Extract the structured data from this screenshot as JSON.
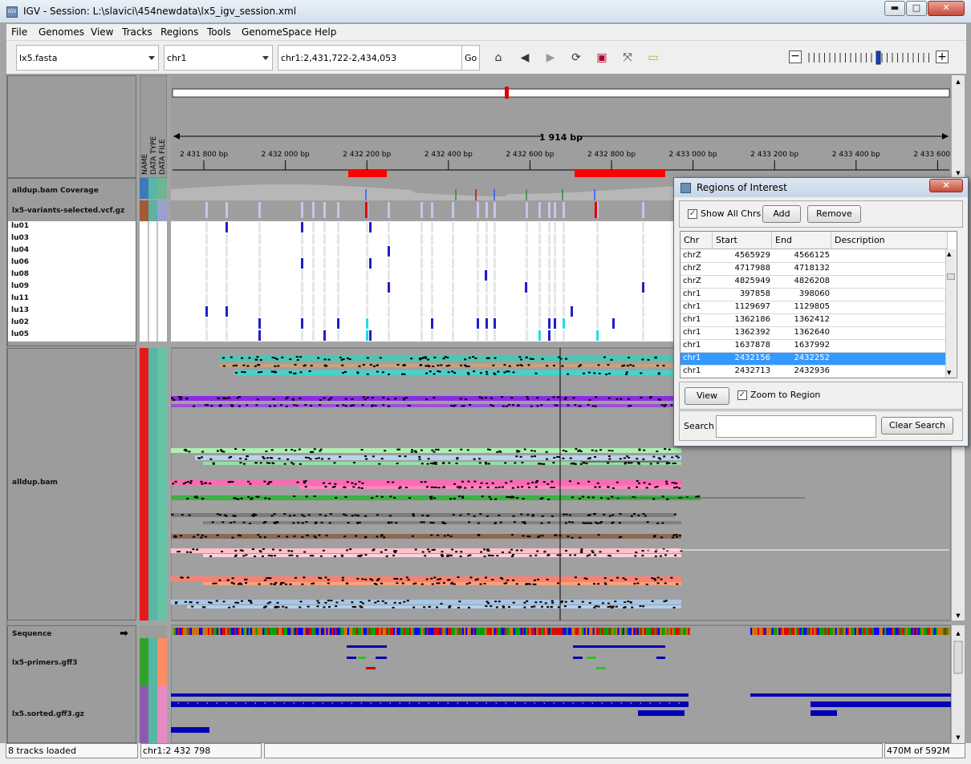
{
  "window": {
    "title": "IGV - Session: L:\\slavici\\454newdata\\lx5_igv_session.xml",
    "minimize": "▬",
    "maximize": "□",
    "close": "✕"
  },
  "menu": [
    "File",
    "Genomes",
    "View",
    "Tracks",
    "Regions",
    "Tools",
    "GenomeSpace",
    "Help"
  ],
  "toolbar": {
    "genome": "lx5.fasta",
    "chromosome": "chr1",
    "locus": "chr1:2,431,722-2,434,053",
    "go": "Go",
    "zoom_level_fraction": 0.6
  },
  "attribute_headers": [
    "NAME",
    "DATA TYPE",
    "DATA FILE"
  ],
  "ruler": {
    "span": "1 914 bp",
    "ticks": [
      "2 431 800 bp",
      "2 432 000 bp",
      "2 432 200 bp",
      "2 432 400 bp",
      "2 432 600 bp",
      "2 432 800 bp",
      "2 433 000 bp",
      "2 433 200 bp",
      "2 433 400 bp",
      "2 433 600 bp"
    ]
  },
  "tracks": {
    "coverage": "alldup.bam Coverage",
    "variants": "lx5-variants-selected.vcf.gz",
    "samples": [
      "lu01",
      "lu03",
      "lu04",
      "lu06",
      "lu08",
      "lu09",
      "lu11",
      "lu13",
      "lu02",
      "lu05"
    ],
    "alignments": "alldup.bam",
    "sequence": "Sequence",
    "primers": "lx5-primers.gff3",
    "sorted": "lx5.sorted.gff3.gz"
  },
  "roi_dialog": {
    "title": "Regions of Interest",
    "show_all_chrs": "Show All Chrs",
    "add": "Add",
    "remove": "Remove",
    "columns": [
      "Chr",
      "Start",
      "End",
      "Description"
    ],
    "rows": [
      {
        "chr": "chrZ",
        "start": "4565929",
        "end": "4566125",
        "desc": ""
      },
      {
        "chr": "chrZ",
        "start": "4717988",
        "end": "4718132",
        "desc": ""
      },
      {
        "chr": "chrZ",
        "start": "4825949",
        "end": "4826208",
        "desc": ""
      },
      {
        "chr": "chr1",
        "start": "397858",
        "end": "398060",
        "desc": ""
      },
      {
        "chr": "chr1",
        "start": "1129697",
        "end": "1129805",
        "desc": ""
      },
      {
        "chr": "chr1",
        "start": "1362186",
        "end": "1362412",
        "desc": ""
      },
      {
        "chr": "chr1",
        "start": "1362392",
        "end": "1362640",
        "desc": ""
      },
      {
        "chr": "chr1",
        "start": "1637878",
        "end": "1637992",
        "desc": ""
      },
      {
        "chr": "chr1",
        "start": "2432156",
        "end": "2432252",
        "desc": "",
        "selected": true
      },
      {
        "chr": "chr1",
        "start": "2432713",
        "end": "2432936",
        "desc": ""
      }
    ],
    "view": "View",
    "zoom_to_region": "Zoom to Region",
    "search_label": "Search",
    "clear_search": "Clear Search"
  },
  "status": {
    "tracks_loaded": "8 tracks loaded",
    "position": "chr1:2 432 798",
    "message": "",
    "memory": "470M of 592M"
  }
}
